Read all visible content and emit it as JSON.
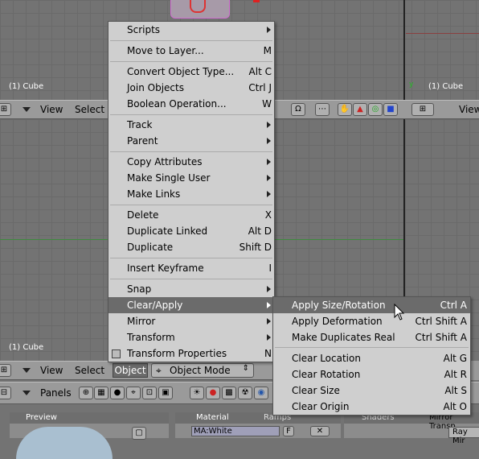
{
  "viewports": {
    "top_right_label": "(1) Cube",
    "left_mid_label": "(1) Cube",
    "left_bottom_label": "(1) Cube"
  },
  "header_mid": {
    "view_label": "View",
    "select_label": "Select",
    "right_view_label": "View"
  },
  "header_bottom": {
    "view_label": "View",
    "select_label": "Select",
    "object_label": "Object",
    "mode_label": "Object Mode"
  },
  "buttons_window": {
    "panels_label": "Panels"
  },
  "object_menu": {
    "items": [
      {
        "label": "Scripts",
        "shortcut": "",
        "submenu": true
      },
      {
        "label": "Move to Layer...",
        "shortcut": "M",
        "submenu": false
      },
      {
        "label": "Convert Object Type...",
        "shortcut": "Alt C",
        "submenu": false
      },
      {
        "label": "Join Objects",
        "shortcut": "Ctrl J",
        "submenu": false
      },
      {
        "label": "Boolean Operation...",
        "shortcut": "W",
        "submenu": false
      },
      {
        "label": "Track",
        "shortcut": "",
        "submenu": true
      },
      {
        "label": "Parent",
        "shortcut": "",
        "submenu": true
      },
      {
        "label": "Copy Attributes",
        "shortcut": "",
        "submenu": true
      },
      {
        "label": "Make Single User",
        "shortcut": "",
        "submenu": true
      },
      {
        "label": "Make Links",
        "shortcut": "",
        "submenu": true
      },
      {
        "label": "Delete",
        "shortcut": "X",
        "submenu": false
      },
      {
        "label": "Duplicate Linked",
        "shortcut": "Alt D",
        "submenu": false
      },
      {
        "label": "Duplicate",
        "shortcut": "Shift D",
        "submenu": false
      },
      {
        "label": "Insert Keyframe",
        "shortcut": "I",
        "submenu": false
      },
      {
        "label": "Snap",
        "shortcut": "",
        "submenu": true
      },
      {
        "label": "Clear/Apply",
        "shortcut": "",
        "submenu": true
      },
      {
        "label": "Mirror",
        "shortcut": "",
        "submenu": true
      },
      {
        "label": "Transform",
        "shortcut": "",
        "submenu": true
      },
      {
        "label": "Transform Properties",
        "shortcut": "N",
        "submenu": false
      }
    ]
  },
  "clear_apply_menu": {
    "items": [
      {
        "label": "Apply Size/Rotation",
        "shortcut": "Ctrl A"
      },
      {
        "label": "Apply Deformation",
        "shortcut": "Ctrl Shift A"
      },
      {
        "label": "Make Duplicates Real",
        "shortcut": "Ctrl Shift A"
      },
      {
        "label": "Clear Location",
        "shortcut": "Alt G"
      },
      {
        "label": "Clear Rotation",
        "shortcut": "Alt R"
      },
      {
        "label": "Clear Size",
        "shortcut": "Alt S"
      },
      {
        "label": "Clear Origin",
        "shortcut": "Alt O"
      }
    ]
  },
  "bottom_panels": {
    "preview_tab": "Preview",
    "material_tab": "Material",
    "ramps_tab": "Ramps",
    "material_name": "MA:White",
    "material_f": "F",
    "shaders_tab": "Shaders",
    "mirror_tab": "Mirror Transp",
    "raymir_label": "Ray Mir"
  }
}
